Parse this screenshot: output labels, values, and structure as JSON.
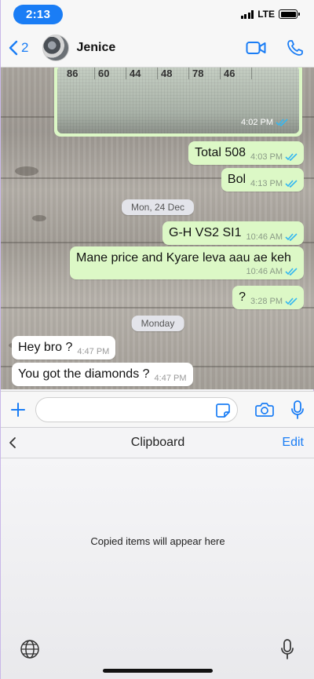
{
  "status_bar": {
    "time": "2:13",
    "network": "LTE"
  },
  "header": {
    "back_count": "2",
    "contact_name": "Jenice"
  },
  "image_message": {
    "numbers": [
      "86",
      "60",
      "44",
      "48",
      "78",
      "46"
    ],
    "time": "4:02 PM"
  },
  "messages": [
    {
      "id": "m1",
      "text": "Total 508",
      "time": "4:03 PM",
      "direction": "outgoing"
    },
    {
      "id": "m2",
      "text": "Bol",
      "time": "4:13 PM",
      "direction": "outgoing"
    },
    {
      "id": "m3",
      "text": "G-H VS2 SI1",
      "time": "10:46 AM",
      "direction": "outgoing"
    },
    {
      "id": "m4",
      "text": "Mane price and Kyare leva aau ae keh",
      "time": "10:46 AM",
      "direction": "outgoing"
    },
    {
      "id": "m5",
      "text": "?",
      "time": "3:28 PM",
      "direction": "outgoing"
    },
    {
      "id": "m6",
      "text": "Hey bro ?",
      "time": "4:47 PM",
      "direction": "incoming"
    },
    {
      "id": "m7",
      "text": "You got the diamonds ?",
      "time": "4:47 PM",
      "direction": "incoming"
    }
  ],
  "date_separators": [
    "Mon, 24 Dec",
    "Monday"
  ],
  "input": {
    "placeholder": ""
  },
  "keyboard": {
    "title": "Clipboard",
    "edit_label": "Edit",
    "empty_message": "Copied items will appear here"
  },
  "colors": {
    "accent": "#1a7df5",
    "outgoing_bubble": "#dcf8c6",
    "incoming_bubble": "#ffffff",
    "read_ticks": "#34b7f1"
  }
}
